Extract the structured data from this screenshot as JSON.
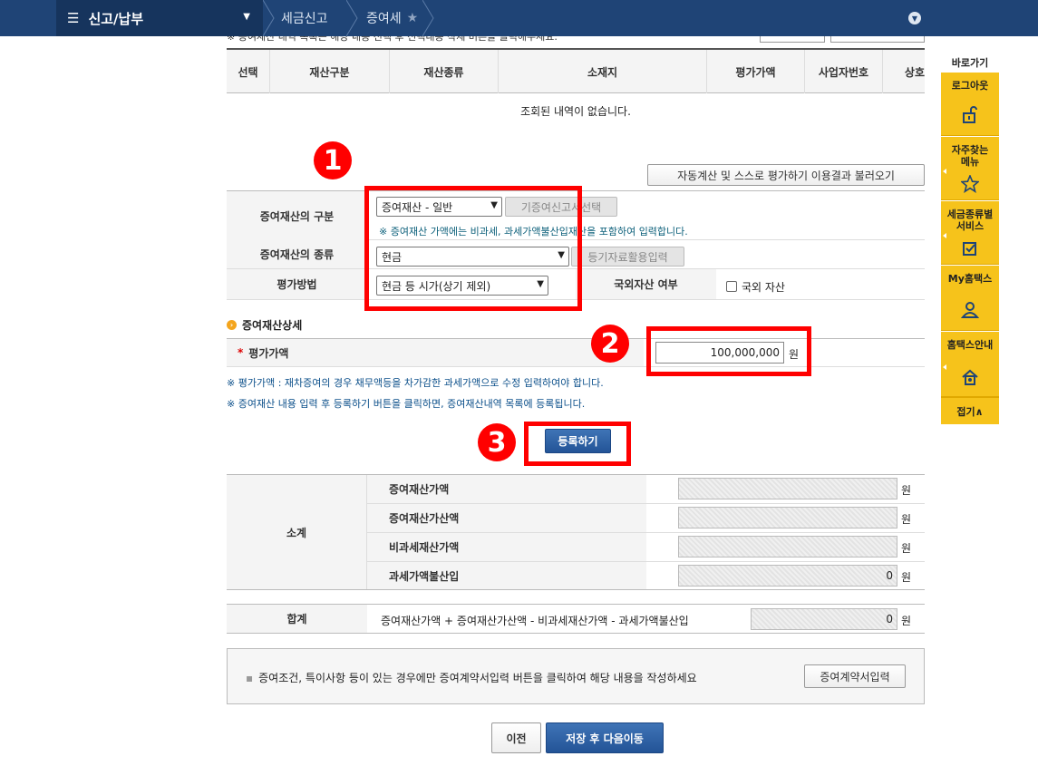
{
  "nav": {
    "menu_label": "신고/납부",
    "crumb1": "세금신고",
    "crumb2": "증여세"
  },
  "top_note": "※ 증여재산 내역 목록은 해당 내용 선택 후 선택내용 삭제 버튼을 클릭해주세요.",
  "list": {
    "headers": [
      "선택",
      "재산구분",
      "재산종류",
      "소재지",
      "평가가액",
      "사업자번호",
      "상호"
    ],
    "empty_message": "조회된 내역이 없습니다."
  },
  "load_button": "자동계산 및 스스로 평가하기 이용결과 불러오기",
  "form": {
    "category_label": "증여재산의 구분",
    "category_value": "증여재산 - 일반",
    "prior_button": "기증여신고서선택",
    "category_note": "※ 증여재산 가액에는 비과세, 과세가액불산입재산을 포함하여 입력합니다.",
    "type_label": "증여재산의 종류",
    "type_value": "현금",
    "registry_button": "등기자료활용입력",
    "method_label": "평가방법",
    "method_value": "현금 등 시가(상기 제외)",
    "foreign_label": "국외자산 여부",
    "foreign_checkbox": "국외 자산"
  },
  "detail": {
    "section_title": "증여재산상세",
    "price_label": "평가가액",
    "required_mark": "*",
    "price_value": "100,000,000",
    "unit": "원",
    "note1": "※ 평가가액 : 재차증여의 경우 채무액등을 차가감한 과세가액으로 수정 입력하여야 합니다.",
    "note2": "※ 증여재산 내용 입력 후 등록하기 버튼을 클릭하면, 증여재산내역 목록에 등록됩니다.",
    "register_button": "등록하기"
  },
  "annotations": {
    "n1": "1",
    "n2": "2",
    "n3": "3"
  },
  "subtotal": {
    "label": "소계",
    "rows": [
      {
        "label": "증여재산가액",
        "value": ""
      },
      {
        "label": "증여재산가산액",
        "value": ""
      },
      {
        "label": "비과세재산가액",
        "value": ""
      },
      {
        "label": "과세가액불산입",
        "value": "0"
      }
    ]
  },
  "total": {
    "label": "합계",
    "formula": "증여재산가액 + 증여재산가산액 - 비과세재산가액 - 과세가액불산입",
    "value": "0"
  },
  "condition": {
    "text": "증여조건, 특이사항 등이 있는 경우에만 증여계약서입력 버튼을 클릭하여 해당 내용을 작성하세요",
    "button": "증여계약서입력"
  },
  "footer": {
    "prev": "이전",
    "save_next": "저장 후 다음이동"
  },
  "quick_menu": {
    "title": "바로가기",
    "items": [
      "로그아웃",
      "자주찾는\n메뉴",
      "세금종류별\n서비스",
      "My홈택스",
      "홈택스안내"
    ],
    "fold": "접기∧"
  },
  "colors": {
    "nav_bg": "#1f4476",
    "accent_yellow": "#f6c31b",
    "annotation_red": "#ff0000"
  }
}
